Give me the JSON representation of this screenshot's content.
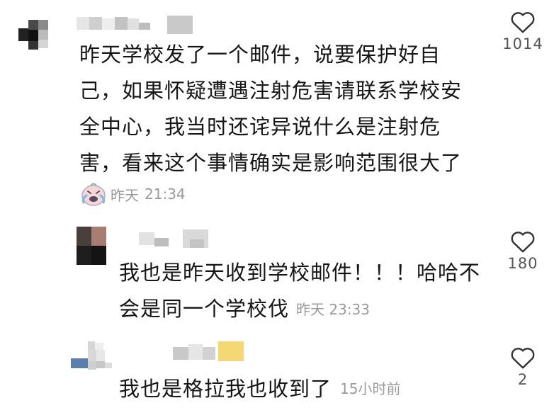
{
  "comments": [
    {
      "text": "昨天学校发了一个邮件，说要保护好自\n己，如果怀疑遭遇注射危害请联系学校安\n全中心，我当时还诧异说什么是注射危\n害，看来这个事情确实是影响范围很大了",
      "time_label": "昨天",
      "time": "21:34",
      "likes": "1014",
      "reaction": "crying-laughing-emoji"
    },
    {
      "text": "我也是昨天收到学校邮件！！！哈哈不\n会是同一个学校伐",
      "time": "昨天 23:33",
      "likes": "180"
    },
    {
      "text": "我也是格拉我也收到了",
      "time": "15小时前",
      "likes": "2"
    }
  ],
  "icons": {
    "like": "heart-outline-icon"
  },
  "colors": {
    "text": "#161616",
    "meta": "#9a9a9a",
    "like_count": "#555555"
  }
}
